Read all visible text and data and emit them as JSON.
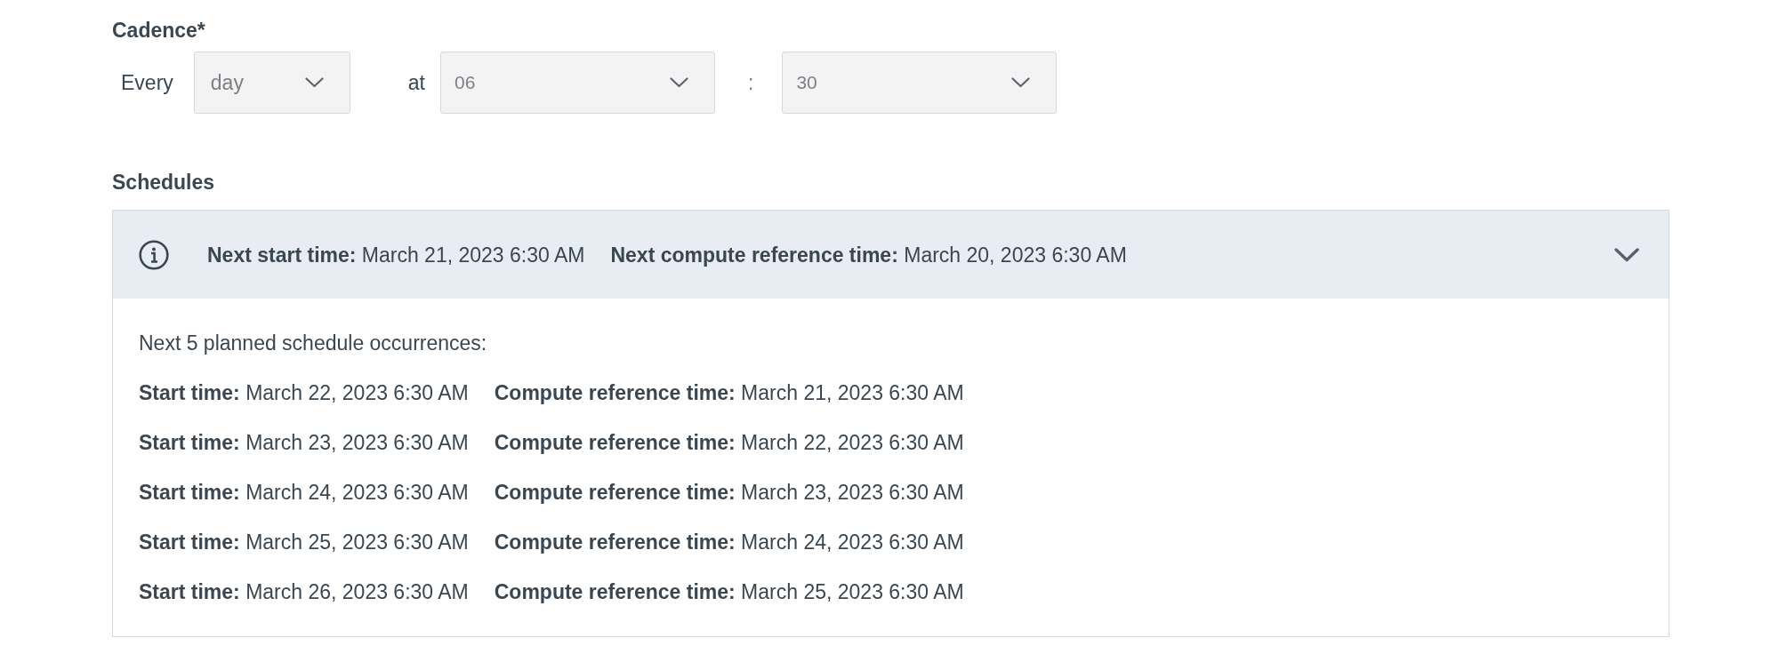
{
  "cadence": {
    "label": "Cadence*",
    "every_label": "Every",
    "unit": {
      "value": "day"
    },
    "at_label": "at",
    "hour": {
      "value": "06"
    },
    "separator": ":",
    "minute": {
      "value": "30"
    }
  },
  "schedules": {
    "label": "Schedules",
    "expanded": true,
    "summary": [
      "**Next start time:** March 21, 2023 6:30 AM",
      "**Next compute reference time:** March 20, 2023 6:30 AM"
    ],
    "occurrences_title": "Next 5 planned schedule occurrences:",
    "occurrences": [
      {
        "start_time": "**Start time:** March 22, 2023 6:30 AM",
        "compute_reference_time": "**Compute reference time:** March 21, 2023 6:30 AM"
      },
      {
        "start_time": "**Start time:** March 23, 2023 6:30 AM",
        "compute_reference_time": "**Compute reference time:** March 22, 2023 6:30 AM"
      },
      {
        "start_time": "**Start time:** March 24, 2023 6:30 AM",
        "compute_reference_time": "**Compute reference time:** March 23, 2023 6:30 AM"
      },
      {
        "start_time": "**Start time:** March 25, 2023 6:30 AM",
        "compute_reference_time": "**Compute reference time:** March 24, 2023 6:30 AM"
      },
      {
        "start_time": "**Start time:** March 26, 2023 6:30 AM",
        "compute_reference_time": "**Compute reference time:** March 25, 2023 6:30 AM"
      }
    ]
  }
}
